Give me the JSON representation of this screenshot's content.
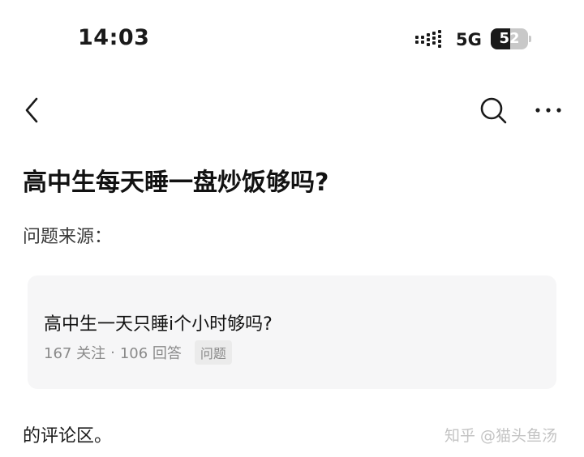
{
  "status_bar": {
    "time": "14:03",
    "network": "5G",
    "battery_level": 52,
    "battery_text": "52"
  },
  "nav": {
    "back_icon": "back-chevron-icon",
    "search_icon": "search-icon",
    "more_icon": "more-dots-icon"
  },
  "question": {
    "title": "高中生每天睡一盘炒饭够吗?",
    "source_label": "问题来源："
  },
  "source_card": {
    "title": "高中生一天只睡i个小时够吗?",
    "followers": "167 关注",
    "separator": "·",
    "answers": "106 回答",
    "tag": "问题"
  },
  "footer": {
    "comment_label": "的评论区。",
    "watermark": "知乎 @猫头鱼汤"
  },
  "colors": {
    "background": "#ffffff",
    "card_background": "#f6f6f7",
    "meta_text": "#8a8a8a"
  }
}
